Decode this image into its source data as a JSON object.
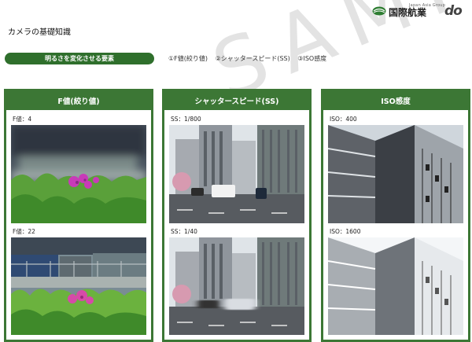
{
  "header": {
    "brand_sub": "Japan Asia Group",
    "brand_name": "国際航業",
    "logo_text": "do"
  },
  "page_title": "カメラの基礎知識",
  "section_pill": "明るさを変化させる要素",
  "factors": [
    "①F値(絞り値)",
    "②シャッタースピード(SS)",
    "③ISO感度"
  ],
  "watermark": "SAMPLE",
  "columns": [
    {
      "title": "F値(絞り値)",
      "photos": [
        {
          "caption": "F値：4",
          "subject": "flower-bokeh"
        },
        {
          "caption": "F値：22",
          "subject": "flower-sharp"
        }
      ]
    },
    {
      "title": "シャッタースピード(SS)",
      "photos": [
        {
          "caption": "SS：1/800",
          "subject": "street-frozen"
        },
        {
          "caption": "SS：1/40",
          "subject": "street-motion"
        }
      ]
    },
    {
      "title": "ISO感度",
      "photos": [
        {
          "caption": "ISO：400",
          "subject": "building-normal"
        },
        {
          "caption": "ISO：1600",
          "subject": "building-bright"
        }
      ]
    }
  ],
  "colors": {
    "accent": "#3c7735",
    "pill": "#2f6f2c",
    "text": "#222222"
  }
}
